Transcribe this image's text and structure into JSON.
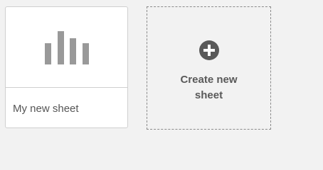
{
  "sheets": [
    {
      "title": "My new sheet",
      "thumbnail_icon": "bar-chart-icon"
    }
  ],
  "create_new": {
    "label_line1": "Create new",
    "label_line2": "sheet",
    "icon": "plus-circle-icon"
  },
  "colors": {
    "background": "#f2f2f2",
    "card": "#ffffff",
    "icon_gray": "#999999",
    "text": "#555555"
  }
}
